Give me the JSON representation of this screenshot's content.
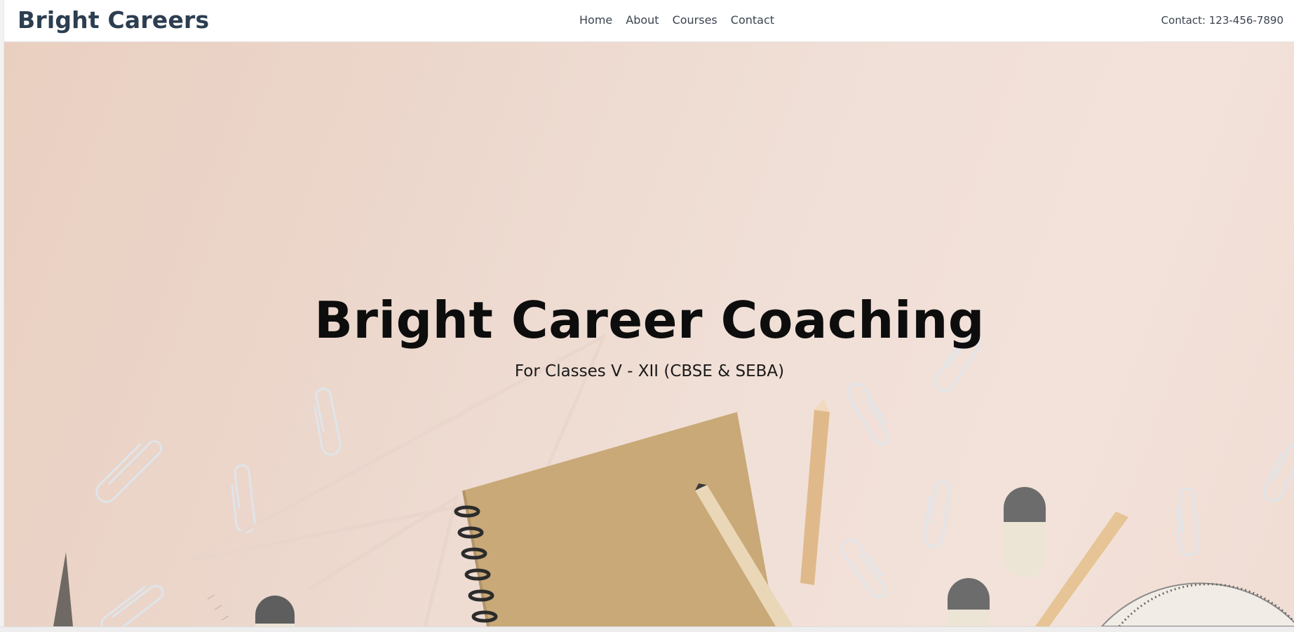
{
  "header": {
    "brand": "Bright Careers",
    "nav": [
      {
        "label": "Home"
      },
      {
        "label": "About"
      },
      {
        "label": "Courses"
      },
      {
        "label": "Contact"
      }
    ],
    "contact": "Contact: 123-456-7890"
  },
  "hero": {
    "title": "Bright Career Coaching",
    "subtitle": "For Classes V - XII (CBSE & SEBA)",
    "background_image": "stationery-flatlay-photo"
  },
  "colors": {
    "brand": "#2c3e50",
    "hero_bg": "#eed8cd",
    "title": "#0d0d0d"
  }
}
